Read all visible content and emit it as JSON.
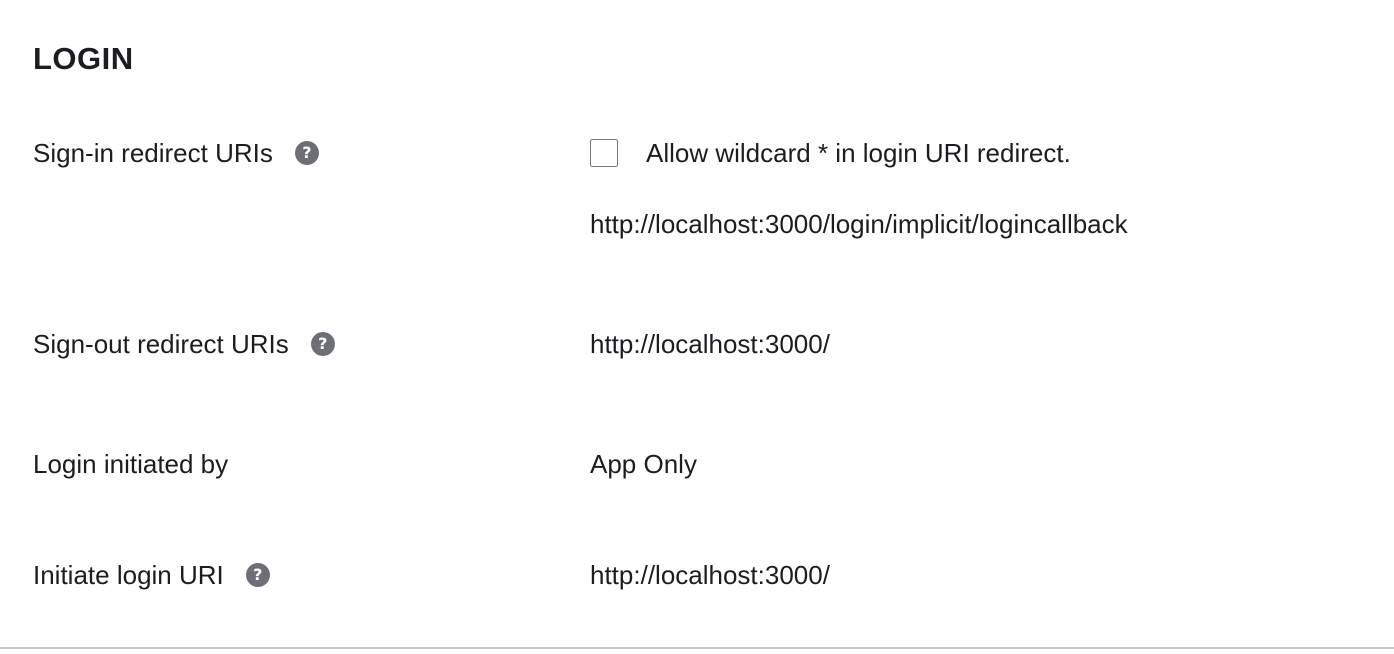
{
  "section": {
    "title": "LOGIN"
  },
  "sign_in": {
    "label": "Sign-in redirect URIs",
    "help_glyph": "?",
    "wildcard_checked": false,
    "wildcard_label": "Allow wildcard * in login URI redirect.",
    "uri": "http://localhost:3000/login/implicit/logincallback"
  },
  "sign_out": {
    "label": "Sign-out redirect URIs",
    "help_glyph": "?",
    "uri": "http://localhost:3000/"
  },
  "login_initiated": {
    "label": "Login initiated by",
    "value": "App Only"
  },
  "initiate_login": {
    "label": "Initiate login URI",
    "help_glyph": "?",
    "uri": "http://localhost:3000/"
  },
  "colors": {
    "text": "#1d1d21",
    "help_icon": "#6e6e78",
    "checkbox_border": "#d7d7dc",
    "divider": "#c8c8cd"
  }
}
